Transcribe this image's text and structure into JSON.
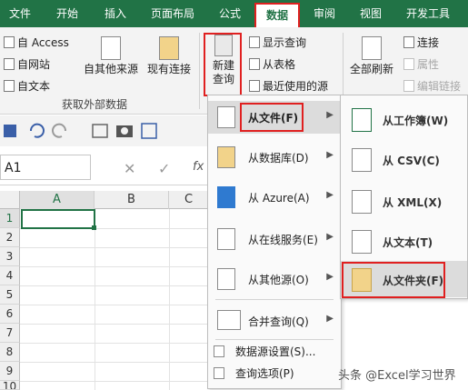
{
  "tabs": [
    "文件",
    "开始",
    "插入",
    "页面布局",
    "公式",
    "数据",
    "审阅",
    "视图",
    "开发工具"
  ],
  "ribbon": {
    "access": "自 Access",
    "web": "自网站",
    "text": "自文本",
    "other_sources": "自其他来源",
    "existing_connections": "现有连接",
    "group_external": "获取外部数据",
    "new_query_line1": "新建",
    "new_query_line2": "查询",
    "show_queries": "显示查询",
    "from_table": "从表格",
    "recent_sources": "最近使用的源",
    "refresh_all_line1": "全部刷新",
    "connections": "连接",
    "properties": "属性",
    "edit_links": "编辑链接"
  },
  "formula": {
    "name_box": "A1",
    "fx": "fx"
  },
  "grid": {
    "columns": [
      "A",
      "B",
      "C"
    ],
    "rows": [
      "1",
      "2",
      "3",
      "4",
      "5",
      "6",
      "7",
      "8",
      "9",
      "10"
    ]
  },
  "menu": {
    "from_file": "从文件(F)",
    "from_database": "从数据库(D)",
    "from_azure": "从 Azure(A)",
    "from_online": "从在线服务(E)",
    "from_other": "从其他源(O)",
    "combine": "合并查询(Q)",
    "source_settings": "数据源设置(S)...",
    "query_options": "查询选项(P)"
  },
  "submenu": {
    "workbook": "从工作簿(W)",
    "csv": "从 CSV(C)",
    "xml": "从 XML(X)",
    "text": "从文本(T)",
    "folder": "从文件夹(F)"
  },
  "watermark": "头条 @Excel学习世界",
  "colors": {
    "excel_green": "#217346",
    "highlight_red": "#e02020",
    "selected_bg": "#dcdcdc"
  }
}
